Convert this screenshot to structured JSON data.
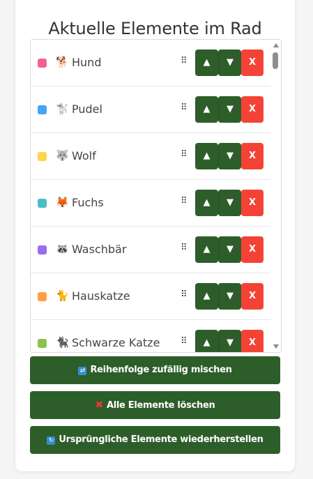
{
  "header": {
    "title": "Aktuelle Elemente im Rad"
  },
  "items": [
    {
      "color": "#f06292",
      "emoji": "🐕",
      "label": "Hund"
    },
    {
      "color": "#42a5f5",
      "emoji": "🐩",
      "label": "Pudel"
    },
    {
      "color": "#ffd54f",
      "emoji": "🐺",
      "label": "Wolf"
    },
    {
      "color": "#4dbdc6",
      "emoji": "🦊",
      "label": "Fuchs"
    },
    {
      "color": "#9c6cf0",
      "emoji": "🦝",
      "label": "Waschbär"
    },
    {
      "color": "#ffa040",
      "emoji": "🐈",
      "label": "Hauskatze"
    },
    {
      "color": "#8bc34a",
      "emoji": "🐈‍⬛",
      "label": "Schwarze Katze"
    }
  ],
  "row_controls": {
    "handle_glyph": "⠿",
    "up_label": "▲",
    "down_label": "▼",
    "delete_label": "X"
  },
  "actions": {
    "shuffle": {
      "icon": "🔀",
      "label": "Reihenfolge zufällig mischen"
    },
    "clear": {
      "icon": "❌",
      "label": "Alle Elemente löschen"
    },
    "restore": {
      "icon": "🔄",
      "label": "Ursprüngliche Elemente wiederherstellen"
    }
  },
  "colors": {
    "primary": "#2d5e2a",
    "danger": "#f44336"
  }
}
